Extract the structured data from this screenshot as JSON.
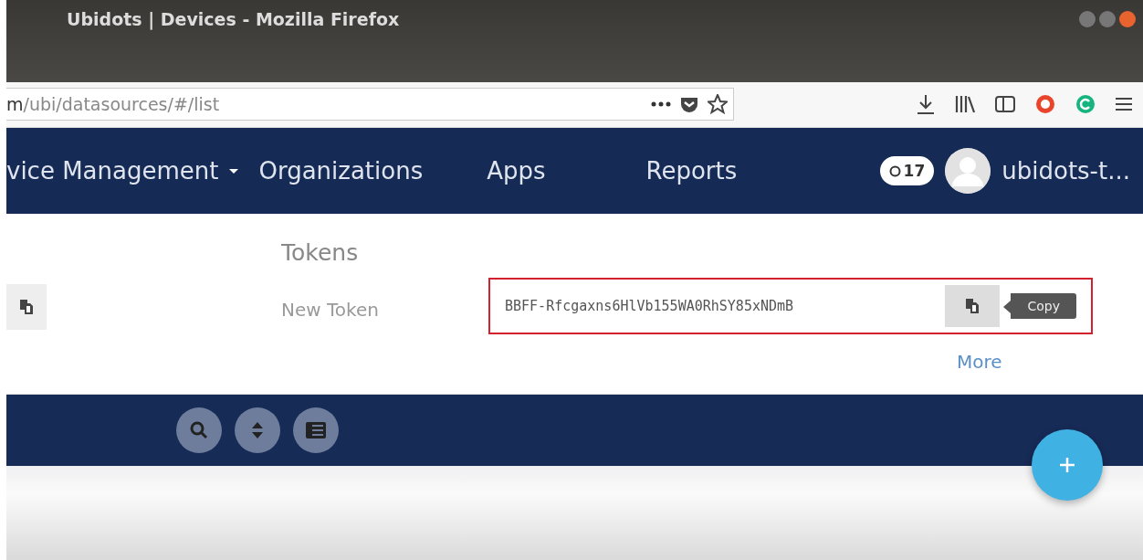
{
  "window": {
    "title": "Ubidots | Devices - Mozilla Firefox"
  },
  "address_bar": {
    "url": "**m**/ubi/datasources/#/list"
  },
  "nav": {
    "items": [
      {
        "label": "vice Management",
        "dropdown": true
      },
      {
        "label": "Organizations",
        "dropdown": false
      },
      {
        "label": "Apps",
        "dropdown": false
      },
      {
        "label": "Reports",
        "dropdown": false
      }
    ],
    "notifications": "17",
    "user": "ubidots-t..."
  },
  "tokens": {
    "heading": "Tokens",
    "label": "New Token",
    "value": "BBFF-Rfcgaxns6HlVb155WA0RhSY85xNDmB",
    "tooltip": "Copy",
    "more": "More"
  }
}
